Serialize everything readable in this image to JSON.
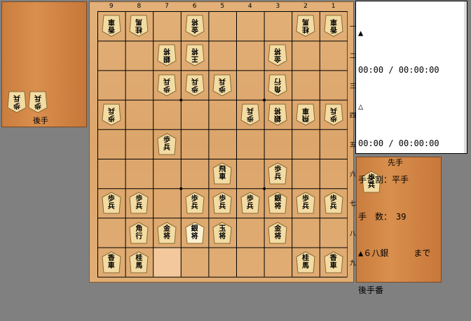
{
  "gote_stand": {
    "label": "後手",
    "pieces": [
      {
        "kanji": "歩兵"
      },
      {
        "kanji": "歩兵"
      }
    ]
  },
  "sente_stand": {
    "label": "先手",
    "pieces": [
      {
        "kanji": "歩兵"
      }
    ]
  },
  "board": {
    "columns": [
      "9",
      "8",
      "7",
      "6",
      "5",
      "4",
      "3",
      "2",
      "1"
    ],
    "rows": [
      "一",
      "二",
      "三",
      "四",
      "五",
      "六",
      "七",
      "八",
      "九"
    ],
    "last_move_square": {
      "col": "7",
      "row": "九"
    },
    "pieces": [
      {
        "col": "9",
        "row": "一",
        "kanji": "香車",
        "owner": "gote"
      },
      {
        "col": "8",
        "row": "一",
        "kanji": "桂馬",
        "owner": "gote"
      },
      {
        "col": "6",
        "row": "一",
        "kanji": "金将",
        "owner": "gote"
      },
      {
        "col": "2",
        "row": "一",
        "kanji": "桂馬",
        "owner": "gote"
      },
      {
        "col": "1",
        "row": "一",
        "kanji": "香車",
        "owner": "gote"
      },
      {
        "col": "7",
        "row": "二",
        "kanji": "銀将",
        "owner": "gote"
      },
      {
        "col": "6",
        "row": "二",
        "kanji": "王将",
        "owner": "gote"
      },
      {
        "col": "3",
        "row": "二",
        "kanji": "金将",
        "owner": "gote"
      },
      {
        "col": "7",
        "row": "三",
        "kanji": "歩兵",
        "owner": "gote"
      },
      {
        "col": "6",
        "row": "三",
        "kanji": "歩兵",
        "owner": "gote"
      },
      {
        "col": "5",
        "row": "三",
        "kanji": "歩兵",
        "owner": "gote"
      },
      {
        "col": "3",
        "row": "三",
        "kanji": "角行",
        "owner": "gote"
      },
      {
        "col": "9",
        "row": "四",
        "kanji": "歩兵",
        "owner": "gote"
      },
      {
        "col": "4",
        "row": "四",
        "kanji": "歩兵",
        "owner": "gote"
      },
      {
        "col": "3",
        "row": "四",
        "kanji": "銀将",
        "owner": "gote"
      },
      {
        "col": "2",
        "row": "四",
        "kanji": "飛車",
        "owner": "gote"
      },
      {
        "col": "1",
        "row": "四",
        "kanji": "歩兵",
        "owner": "gote"
      },
      {
        "col": "7",
        "row": "五",
        "kanji": "歩兵",
        "owner": "sente"
      },
      {
        "col": "5",
        "row": "六",
        "kanji": "飛車",
        "owner": "sente"
      },
      {
        "col": "3",
        "row": "六",
        "kanji": "歩兵",
        "owner": "sente"
      },
      {
        "col": "9",
        "row": "七",
        "kanji": "歩兵",
        "owner": "sente"
      },
      {
        "col": "8",
        "row": "七",
        "kanji": "歩兵",
        "owner": "sente"
      },
      {
        "col": "6",
        "row": "七",
        "kanji": "歩兵",
        "owner": "sente"
      },
      {
        "col": "5",
        "row": "七",
        "kanji": "歩兵",
        "owner": "sente"
      },
      {
        "col": "4",
        "row": "七",
        "kanji": "歩兵",
        "owner": "sente"
      },
      {
        "col": "3",
        "row": "七",
        "kanji": "銀将",
        "owner": "sente"
      },
      {
        "col": "2",
        "row": "七",
        "kanji": "歩兵",
        "owner": "sente"
      },
      {
        "col": "1",
        "row": "七",
        "kanji": "歩兵",
        "owner": "sente"
      },
      {
        "col": "8",
        "row": "八",
        "kanji": "角行",
        "owner": "sente"
      },
      {
        "col": "7",
        "row": "八",
        "kanji": "金将",
        "owner": "sente"
      },
      {
        "col": "6",
        "row": "八",
        "kanji": "銀将",
        "owner": "sente",
        "last_moved": true
      },
      {
        "col": "5",
        "row": "八",
        "kanji": "玉将",
        "owner": "sente"
      },
      {
        "col": "3",
        "row": "八",
        "kanji": "金将",
        "owner": "sente"
      },
      {
        "col": "9",
        "row": "九",
        "kanji": "香車",
        "owner": "sente"
      },
      {
        "col": "8",
        "row": "九",
        "kanji": "桂馬",
        "owner": "sente"
      },
      {
        "col": "2",
        "row": "九",
        "kanji": "桂馬",
        "owner": "sente"
      },
      {
        "col": "1",
        "row": "九",
        "kanji": "香車",
        "owner": "sente"
      }
    ]
  },
  "info": {
    "sente_mark": "▲",
    "sente_time": "00:00 / 00:00:00",
    "gote_mark": "△",
    "gote_time": "00:00 / 00:00:00",
    "handicap": "手合割：平手",
    "move_count": "手　数：　39",
    "last_move": "▲６八銀　　　まで",
    "turn": "後手番"
  }
}
